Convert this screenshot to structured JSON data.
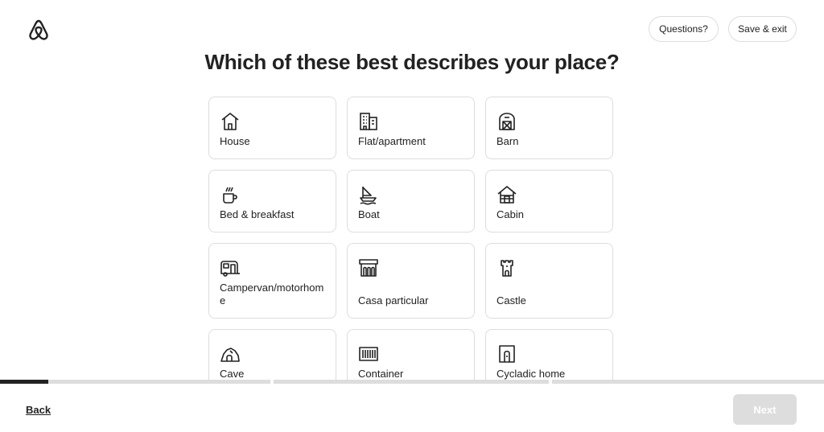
{
  "header": {
    "logo_icon": "airbnb-logo-icon",
    "questions_label": "Questions?",
    "save_exit_label": "Save & exit"
  },
  "title": "Which of these best describes your place?",
  "options": [
    {
      "label": "House",
      "icon": "house-icon"
    },
    {
      "label": "Flat/apartment",
      "icon": "apartment-icon"
    },
    {
      "label": "Barn",
      "icon": "barn-icon"
    },
    {
      "label": "Bed & breakfast",
      "icon": "coffee-cup-icon"
    },
    {
      "label": "Boat",
      "icon": "boat-icon"
    },
    {
      "label": "Cabin",
      "icon": "cabin-icon"
    },
    {
      "label": "Campervan/motorhome",
      "icon": "campervan-icon"
    },
    {
      "label": "Casa particular",
      "icon": "casa-particular-icon"
    },
    {
      "label": "Castle",
      "icon": "castle-icon"
    },
    {
      "label": "Cave",
      "icon": "cave-icon"
    },
    {
      "label": "Container",
      "icon": "container-icon"
    },
    {
      "label": "Cycladic home",
      "icon": "cycladic-home-icon"
    }
  ],
  "progress": {
    "steps": 3,
    "step1_fraction": 0.18,
    "step2_fraction": 0,
    "step3_fraction": 0
  },
  "footer": {
    "back_label": "Back",
    "next_label": "Next"
  },
  "colors": {
    "text": "#222222",
    "border": "#dddddd",
    "disabled_button": "#dddddd"
  }
}
